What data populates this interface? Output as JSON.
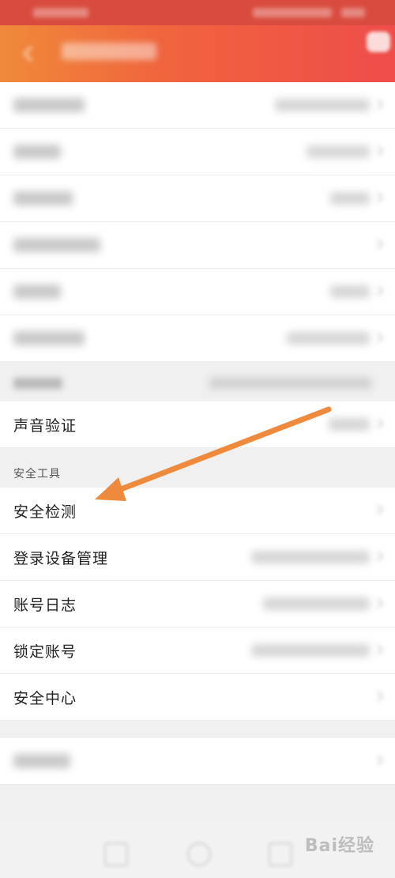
{
  "rows": {
    "voice_verify": "声音验证",
    "security_check": "安全检测",
    "device_manage": "登录设备管理",
    "account_log": "账号日志",
    "lock_account": "锁定账号",
    "security_center": "安全中心"
  },
  "sections": {
    "security_tools": "安全工具"
  },
  "watermark": "Bai经验",
  "colors": {
    "header_start": "#f08a3a",
    "header_end": "#ef4c4a",
    "arrow": "#ef8a3c"
  },
  "icons": {
    "back": "back-arrow-icon",
    "message": "message-icon",
    "chevron": "chevron-right-icon",
    "nav_back": "nav-back-icon",
    "nav_home": "nav-home-icon",
    "nav_recent": "nav-recent-icon"
  }
}
